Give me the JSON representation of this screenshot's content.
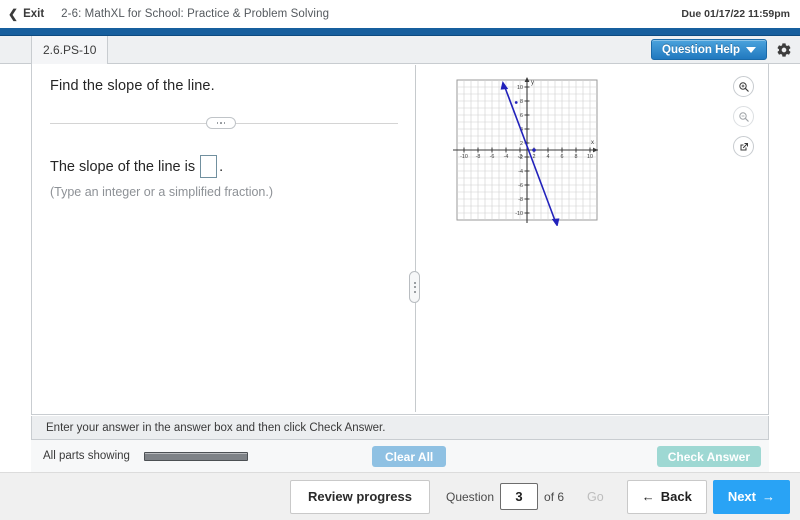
{
  "topbar": {
    "exit_label": "Exit",
    "exit_icon": "chevron-left-icon",
    "assignment_title": "2-6: MathXL for School: Practice & Problem Solving",
    "due_text": "Due 01/17/22 11:59pm",
    "accent_color": "#175f9e"
  },
  "tabs": {
    "active_tab_label": "2.6.PS-10",
    "question_help_label": "Question Help",
    "question_help_caret": "chevron-down-icon",
    "settings_icon": "gear-icon",
    "question_help_color": "#2179bf"
  },
  "question": {
    "title": "Find the slope of the line.",
    "prompt_before": "The slope of the line is",
    "prompt_after": ".",
    "answer_value": "",
    "answer_placeholder": "",
    "hint": "(Type an integer or a simplified fraction.)",
    "divider_icon": "ellipsis-icon"
  },
  "graph_tools": [
    {
      "name": "zoom-in-icon",
      "label": "Zoom in",
      "disabled": false
    },
    {
      "name": "zoom-out-icon",
      "label": "Zoom out",
      "disabled": true
    },
    {
      "name": "expand-icon",
      "label": "Open in new window",
      "disabled": false
    }
  ],
  "chart_data": {
    "type": "line",
    "title": "",
    "xlabel": "x",
    "ylabel": "y",
    "xlim": [
      -10,
      10
    ],
    "ylim": [
      -10,
      10
    ],
    "grid": true,
    "xticks": [
      -10,
      -8,
      -6,
      -4,
      -2,
      2,
      4,
      6,
      8,
      10
    ],
    "yticks": [
      10,
      8,
      6,
      4,
      2,
      -2,
      -4,
      -6,
      -8,
      -10
    ],
    "line_color": "#2222bb",
    "grid_color": "#c9c9c9",
    "series": [
      {
        "name": "line",
        "arrows": "both",
        "slope": -3,
        "y_intercept": 3,
        "x_intercept": 1,
        "points": [
          [
            -3.333,
            10
          ],
          [
            3.333,
            -10
          ]
        ],
        "marked_point": [
          1,
          0
        ]
      }
    ]
  },
  "instruction": {
    "text": "Enter your answer in the answer box and then click Check Answer."
  },
  "actions": {
    "all_parts_label": "All parts showing",
    "progress_percent": 100,
    "clear_all_label": "Clear All",
    "check_answer_label": "Check Answer",
    "clear_all_color": "#8fc1e3",
    "check_answer_color": "#9ed8d3"
  },
  "bottomnav": {
    "review_progress_label": "Review progress",
    "question_label": "Question",
    "question_number": "3",
    "of_label": "of 6",
    "go_label": "Go",
    "back_label": "Back",
    "back_icon": "arrow-left-icon",
    "next_label": "Next",
    "next_icon": "arrow-right-icon",
    "next_color": "#29a3f5"
  }
}
